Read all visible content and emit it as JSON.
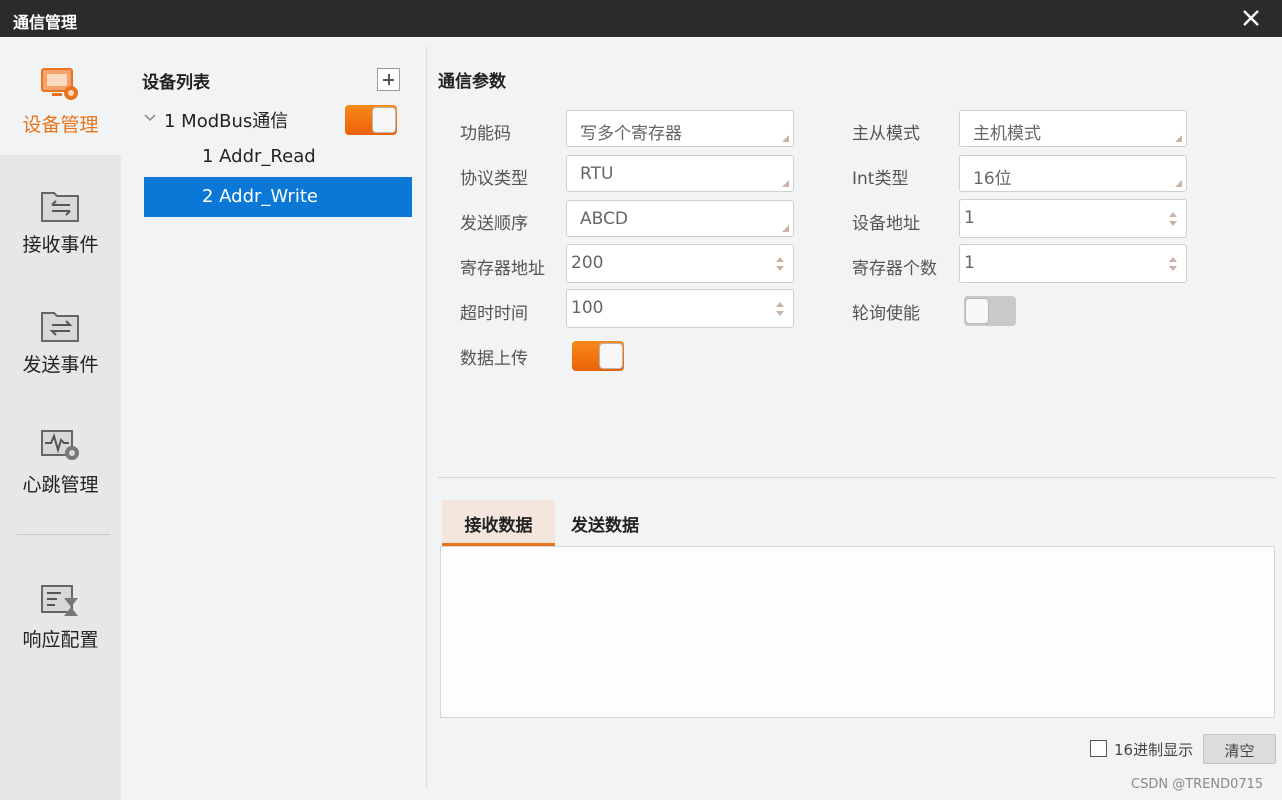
{
  "window": {
    "title": "通信管理"
  },
  "nav": {
    "items": [
      {
        "label": "设备管理",
        "icon": "device-management-icon",
        "active": true
      },
      {
        "label": "接收事件",
        "icon": "receive-event-icon",
        "active": false
      },
      {
        "label": "发送事件",
        "icon": "send-event-icon",
        "active": false
      },
      {
        "label": "心跳管理",
        "icon": "heartbeat-icon",
        "active": false
      },
      {
        "label": "响应配置",
        "icon": "response-config-icon",
        "active": false
      }
    ]
  },
  "devices": {
    "header": "设备列表",
    "root": {
      "label": "1 ModBus通信",
      "enabled": true
    },
    "children": [
      {
        "label": "1 Addr_Read",
        "selected": false
      },
      {
        "label": "2 Addr_Write",
        "selected": true
      }
    ]
  },
  "params": {
    "title": "通信参数",
    "function_code": {
      "label": "功能码",
      "value": "写多个寄存器"
    },
    "master_slave": {
      "label": "主从模式",
      "value": "主机模式"
    },
    "protocol": {
      "label": "协议类型",
      "value": "RTU"
    },
    "int_type": {
      "label": "Int类型",
      "value": "16位"
    },
    "send_order": {
      "label": "发送顺序",
      "value": "ABCD"
    },
    "device_addr": {
      "label": "设备地址",
      "value": "1"
    },
    "register_addr": {
      "label": "寄存器地址",
      "value": "200"
    },
    "register_count": {
      "label": "寄存器个数",
      "value": "1"
    },
    "timeout": {
      "label": "超时时间",
      "value": "100"
    },
    "polling": {
      "label": "轮询使能",
      "enabled": false
    },
    "upload": {
      "label": "数据上传",
      "enabled": true
    }
  },
  "data_tabs": {
    "receive": "接收数据",
    "send": "发送数据",
    "active": "receive"
  },
  "footer": {
    "hex_label": "16进制显示",
    "hex_checked": false,
    "clear_label": "清空",
    "watermark": "CSDN @TREND0715"
  },
  "colors": {
    "accent": "#e8741c",
    "selection": "#0b78d7",
    "titlebar": "#2b2b2b"
  }
}
